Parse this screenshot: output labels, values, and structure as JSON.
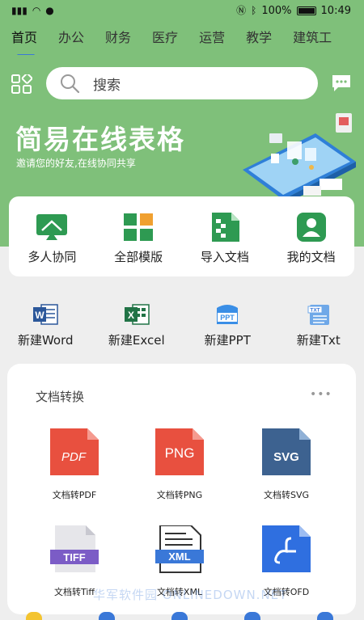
{
  "status_bar": {
    "battery_percent": "100%",
    "time": "10:49"
  },
  "tabs": [
    {
      "label": "首页",
      "active": true
    },
    {
      "label": "办公"
    },
    {
      "label": "财务"
    },
    {
      "label": "医疗"
    },
    {
      "label": "运营"
    },
    {
      "label": "教学"
    },
    {
      "label": "建筑工"
    }
  ],
  "search": {
    "placeholder": "搜索"
  },
  "hero": {
    "title": "简易在线表格",
    "subtitle": "邀请您的好友,在线协同共享"
  },
  "quick_actions": [
    {
      "label": "多人协同",
      "icon": "monitor-icon"
    },
    {
      "label": "全部模版",
      "icon": "grid-template-icon"
    },
    {
      "label": "导入文档",
      "icon": "import-doc-icon"
    },
    {
      "label": "我的文档",
      "icon": "user-doc-icon"
    }
  ],
  "new_docs": [
    {
      "label": "新建Word",
      "icon": "word-icon"
    },
    {
      "label": "新建Excel",
      "icon": "excel-icon"
    },
    {
      "label": "新建PPT",
      "icon": "ppt-icon"
    },
    {
      "label": "新建Txt",
      "icon": "txt-icon"
    }
  ],
  "conversion": {
    "title": "文档转换",
    "more": "•••",
    "items": [
      {
        "label": "文档转PDF",
        "badge": "PDF",
        "color": "#e8503f"
      },
      {
        "label": "文档转PNG",
        "badge": "PNG",
        "color": "#e8503f"
      },
      {
        "label": "文档转SVG",
        "badge": "SVG",
        "color": "#3d6290"
      },
      {
        "label": "文档转Tiff",
        "badge": "TIFF",
        "color": "#7b5cc6"
      },
      {
        "label": "文档转XML",
        "badge": "XML",
        "color": "#3a78d8"
      },
      {
        "label": "文档转OFD",
        "badge": "",
        "color": "#2f6fe0"
      }
    ]
  },
  "watermark": "华军软件园 ONLINEDOWN.NET",
  "colors": {
    "hero_green": "#7fc07a",
    "tab_indicator": "#3a78d8",
    "quick_icon_green": "#2e9a52"
  }
}
